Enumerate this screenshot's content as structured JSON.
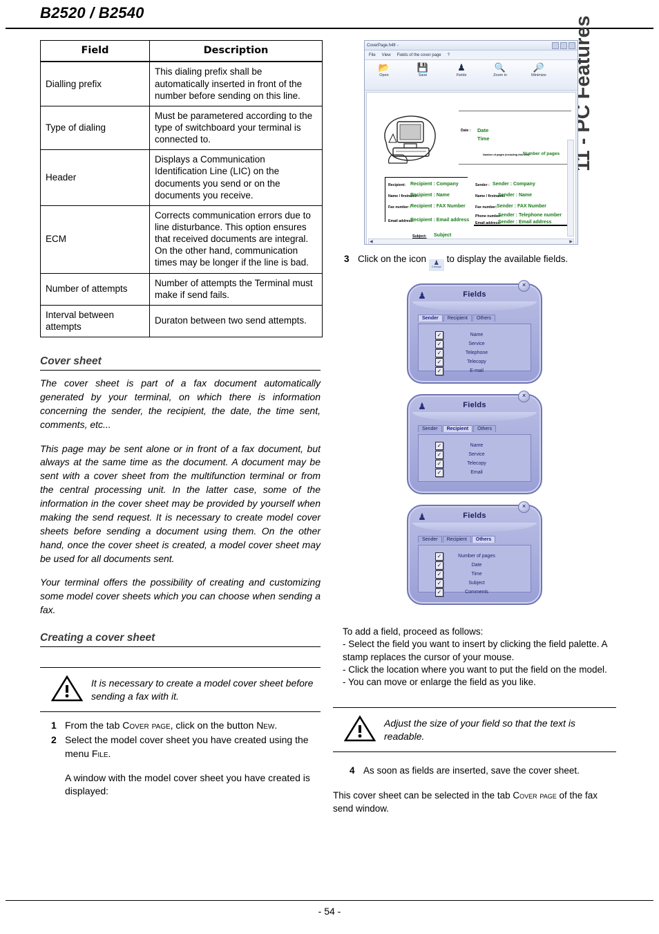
{
  "header": {
    "doc_title": "B2520 / B2540",
    "side_tab": "11 - PC Features"
  },
  "footer": {
    "page_number": "- 54 -"
  },
  "table": {
    "columns": [
      "Field",
      "Description"
    ],
    "rows": [
      {
        "field": "Dialling prefix",
        "description": "This dialing prefix shall be automatically inserted in front of the number before sending on this line."
      },
      {
        "field": "Type of dialing",
        "description": "Must be parametered according to the type of switchboard your terminal is connected to."
      },
      {
        "field": "Header",
        "description": "Displays a Communication Identification Line (LIC) on the documents you send or on the documents you receive."
      },
      {
        "field": "ECM",
        "description": "Corrects communication errors due to line disturbance. This option ensures that received documents are integral. On the other hand, communication times may be longer if the line is bad."
      },
      {
        "field": "Number of attempts",
        "description": "Number of attempts the Terminal must make if send fails."
      },
      {
        "field": "Interval between attempts",
        "description": "Duraton between two send attempts."
      }
    ]
  },
  "cover_sheet": {
    "heading": "Cover sheet",
    "para1": "The cover sheet is part of a fax document automatically generated by your terminal, on which there is information concerning the sender, the recipient, the date, the time sent, comments, etc...",
    "para2": "This page may be sent alone or in front of a fax document, but always at the same time as the document. A document may be sent with a cover sheet from the multifunction terminal or from the central processing unit. In the latter case, some of the information in the cover sheet may be provided by yourself when making the send request. It is necessary to create model cover sheets before sending a document using them. On the other hand, once the cover sheet is created, a model cover sheet may be used for all documents sent.",
    "para3": "Your terminal offers the possibility of creating and customizing some model cover sheets which you can choose when sending a fax."
  },
  "creating": {
    "heading": "Creating a cover sheet",
    "note": "It is necessary to create a model cover sheet before sending a fax with it.",
    "steps": [
      {
        "num": "1",
        "text_pre": "From the tab ",
        "sc1": "Cover page",
        "text_mid": ", click on the button ",
        "sc2": "New",
        "text_post": "."
      },
      {
        "num": "2",
        "text_pre": "Select the model cover sheet you have created using the menu ",
        "sc1": "File",
        "text_mid": "",
        "sc2": "",
        "text_post": "."
      }
    ],
    "after_steps": "A window with the model cover sheet you have created is displayed:"
  },
  "app_shot": {
    "window_title": "CoverPage.h4fr -",
    "menus": [
      "File",
      "View",
      "Fields of the cover page",
      "?"
    ],
    "toolbar": [
      {
        "label": "Open",
        "icon": "open-folder-icon",
        "glyph": "Ὄ2"
      },
      {
        "label": "Save",
        "icon": "save-disk-icon",
        "glyph": "ὋE"
      },
      {
        "label": "Fields",
        "icon": "stamp-icon",
        "glyph": "♙"
      },
      {
        "label": "Zoom in",
        "icon": "zoom-in-icon",
        "glyph": "ὐD"
      },
      {
        "label": "Minimize",
        "icon": "zoom-out-icon",
        "glyph": "ὐE"
      }
    ],
    "canvas": {
      "date_label": "Date :",
      "date_value": "Date",
      "time_value": "Time",
      "pages_label": "Number of pages (including this one) :",
      "pages_value": "Number of pages",
      "recipient": [
        {
          "label": "Recipient:",
          "value": "Recipient : Company"
        },
        {
          "label": "Name / firstname :",
          "value": "Recipient : Name"
        },
        {
          "label": "Fax number :",
          "value": "Recipient : FAX Number"
        },
        {
          "label": "Email address:",
          "value": "Recipient : Email address"
        }
      ],
      "sender": [
        {
          "label": "Sender :",
          "value": "Sender : Company"
        },
        {
          "label": "Name / firstname:",
          "value": "Sender : Name"
        },
        {
          "label": "Fax number:",
          "value": "Sender : FAX Number"
        },
        {
          "label": "Phone number:",
          "value": "Sender : Telephone number"
        },
        {
          "label": "Email address:",
          "value": "Sender : Email address"
        }
      ],
      "subject_label": "Subject:",
      "subject_value": "Subject"
    }
  },
  "step3": {
    "num": "3",
    "text_pre": "Click on the icon",
    "icon_label": "Champs",
    "text_post": "to display the available fields."
  },
  "fields_dialogs": [
    {
      "title": "Fields",
      "tabs": [
        "Sender",
        "Recipient",
        "Others"
      ],
      "active_tab": "Sender",
      "items": [
        "Name",
        "Service",
        "Telephone",
        "Telecopy",
        "E-mail"
      ]
    },
    {
      "title": "Fields",
      "tabs": [
        "Sender",
        "Recipient",
        "Others"
      ],
      "active_tab": "Recipient",
      "items": [
        "Name",
        "Service",
        "Telecopy",
        "Email"
      ]
    },
    {
      "title": "Fields",
      "tabs": [
        "Sender",
        "Recipient",
        "Others"
      ],
      "active_tab": "Others",
      "items": [
        "Number of pages",
        "Date",
        "Time",
        "Subject",
        "Comments"
      ]
    }
  ],
  "add_field": {
    "line1": "To add a field, proceed as follows:",
    "line2": "- Select the field you want to insert by clicking the field palette. A stamp replaces the cursor of your mouse.",
    "line3": "- Click the location where you want to put the field on the model.",
    "line4": "- You can move or enlarge the field as you like."
  },
  "note2": "Adjust the size of your field so that the text is readable.",
  "step4": {
    "num": "4",
    "text": "As soon as fields are inserted, save the cover sheet."
  },
  "closing": {
    "text_pre": "This cover sheet can be selected in the tab ",
    "sc": "Cover page",
    "text_post": " of the fax send window."
  },
  "colors": {
    "dialog_body": "#9aa0d6",
    "dialog_border": "#6f74b5",
    "field_value_green": "#1a7a1a",
    "heading_gray": "#3b3b3b"
  }
}
